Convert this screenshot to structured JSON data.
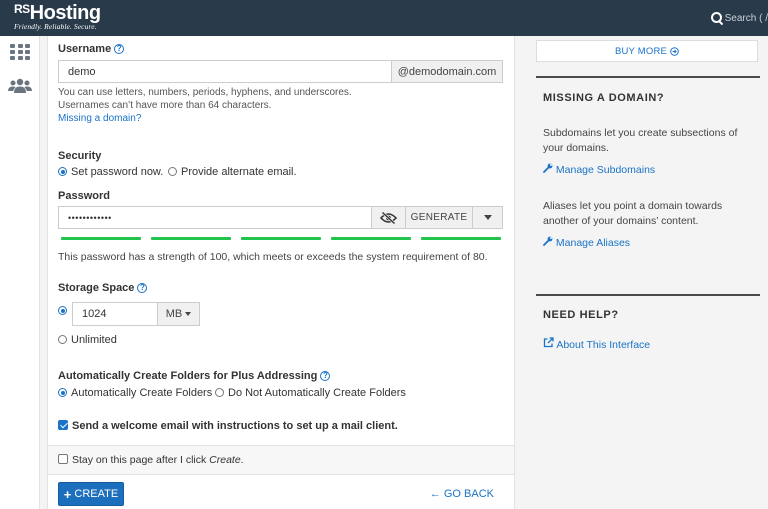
{
  "header": {
    "brand_prefix": "RS",
    "brand_name": "Hosting",
    "tagline": "Friendly. Reliable. Secure.",
    "search_label": "Search ( /"
  },
  "form": {
    "username": {
      "label": "Username",
      "value": "demo",
      "domain_suffix": "@demodomain.com",
      "hint_line1": "You can use letters, numbers, periods, hyphens, and underscores.",
      "hint_line2": "Usernames can’t have more than 64 characters.",
      "missing_domain_link": "Missing a domain?"
    },
    "security": {
      "label": "Security",
      "option_set_now": "Set password now.",
      "option_alternate": "Provide alternate email.",
      "selected": "set_now"
    },
    "password": {
      "label": "Password",
      "value": "••••••••••••",
      "generate_label": "GENERATE",
      "strength_segments_filled": 5,
      "strength_segments_total": 5,
      "strength_message": "This password has a strength of 100, which meets or exceeds the system requirement of 80."
    },
    "storage": {
      "label": "Storage Space",
      "value": "1024",
      "unit": "MB",
      "unlimited_label": "Unlimited",
      "selected": "custom"
    },
    "folders": {
      "label": "Automatically Create Folders for Plus Addressing",
      "option_auto": "Automatically Create Folders",
      "option_no": "Do Not Automatically Create Folders",
      "selected": "auto"
    },
    "welcome_email": {
      "label": "Send a welcome email with instructions to set up a mail client.",
      "checked": true
    },
    "stay_on_page": {
      "label_prefix": "Stay on this page after I click ",
      "label_emph": "Create",
      "label_suffix": ".",
      "checked": false
    },
    "create_label": "CREATE",
    "go_back_label": "GO BACK"
  },
  "sidebar_right": {
    "buy_more_label": "BUY MORE",
    "missing_domain": {
      "title": "MISSING A DOMAIN?",
      "subdomains_text": "Subdomains let you create subsections of your domains.",
      "subdomains_link": "Manage Subdomains",
      "aliases_text": "Aliases let you point a domain towards another of your domains’ content.",
      "aliases_link": "Manage Aliases"
    },
    "need_help": {
      "title": "NEED HELP?",
      "link": "About This Interface"
    }
  },
  "colors": {
    "topbar": "#293a4a",
    "accent": "#1a73c8",
    "strength": "#22c54b"
  }
}
